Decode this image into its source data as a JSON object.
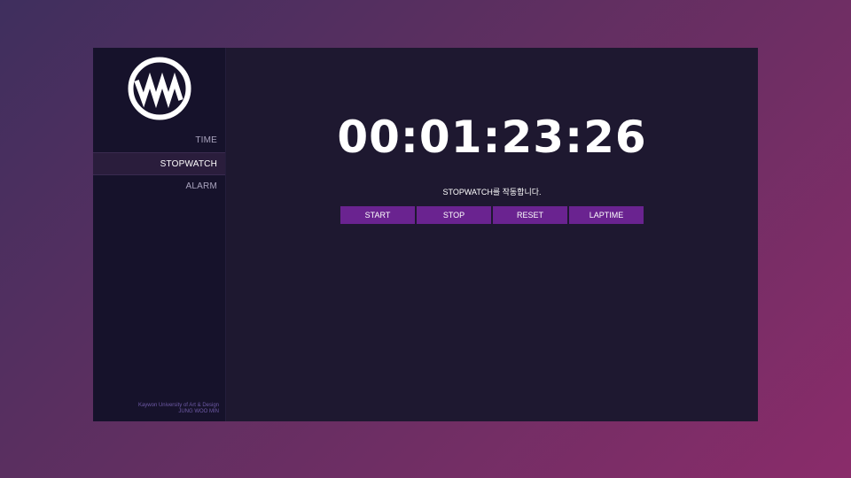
{
  "sidebar": {
    "logo_icon": "wave-circle-logo",
    "items": [
      {
        "label": "TIME",
        "active": false
      },
      {
        "label": "STOPWATCH",
        "active": true
      },
      {
        "label": "ALARM",
        "active": false
      }
    ],
    "credit_line1": "Kaywon University of Art & Design",
    "credit_line2": "JUNG WOO MIN"
  },
  "stopwatch": {
    "time": "00:01:23:26",
    "message": "STOPWATCH를 작동합니다.",
    "buttons": {
      "start": "START",
      "stop": "STOP",
      "reset": "RESET",
      "laptime": "LAPTIME"
    }
  },
  "colors": {
    "button_bg": "#6a2390",
    "sidebar_bg": "#16122b",
    "main_bg": "#1e1830",
    "credit_text": "#6e5aa6"
  }
}
